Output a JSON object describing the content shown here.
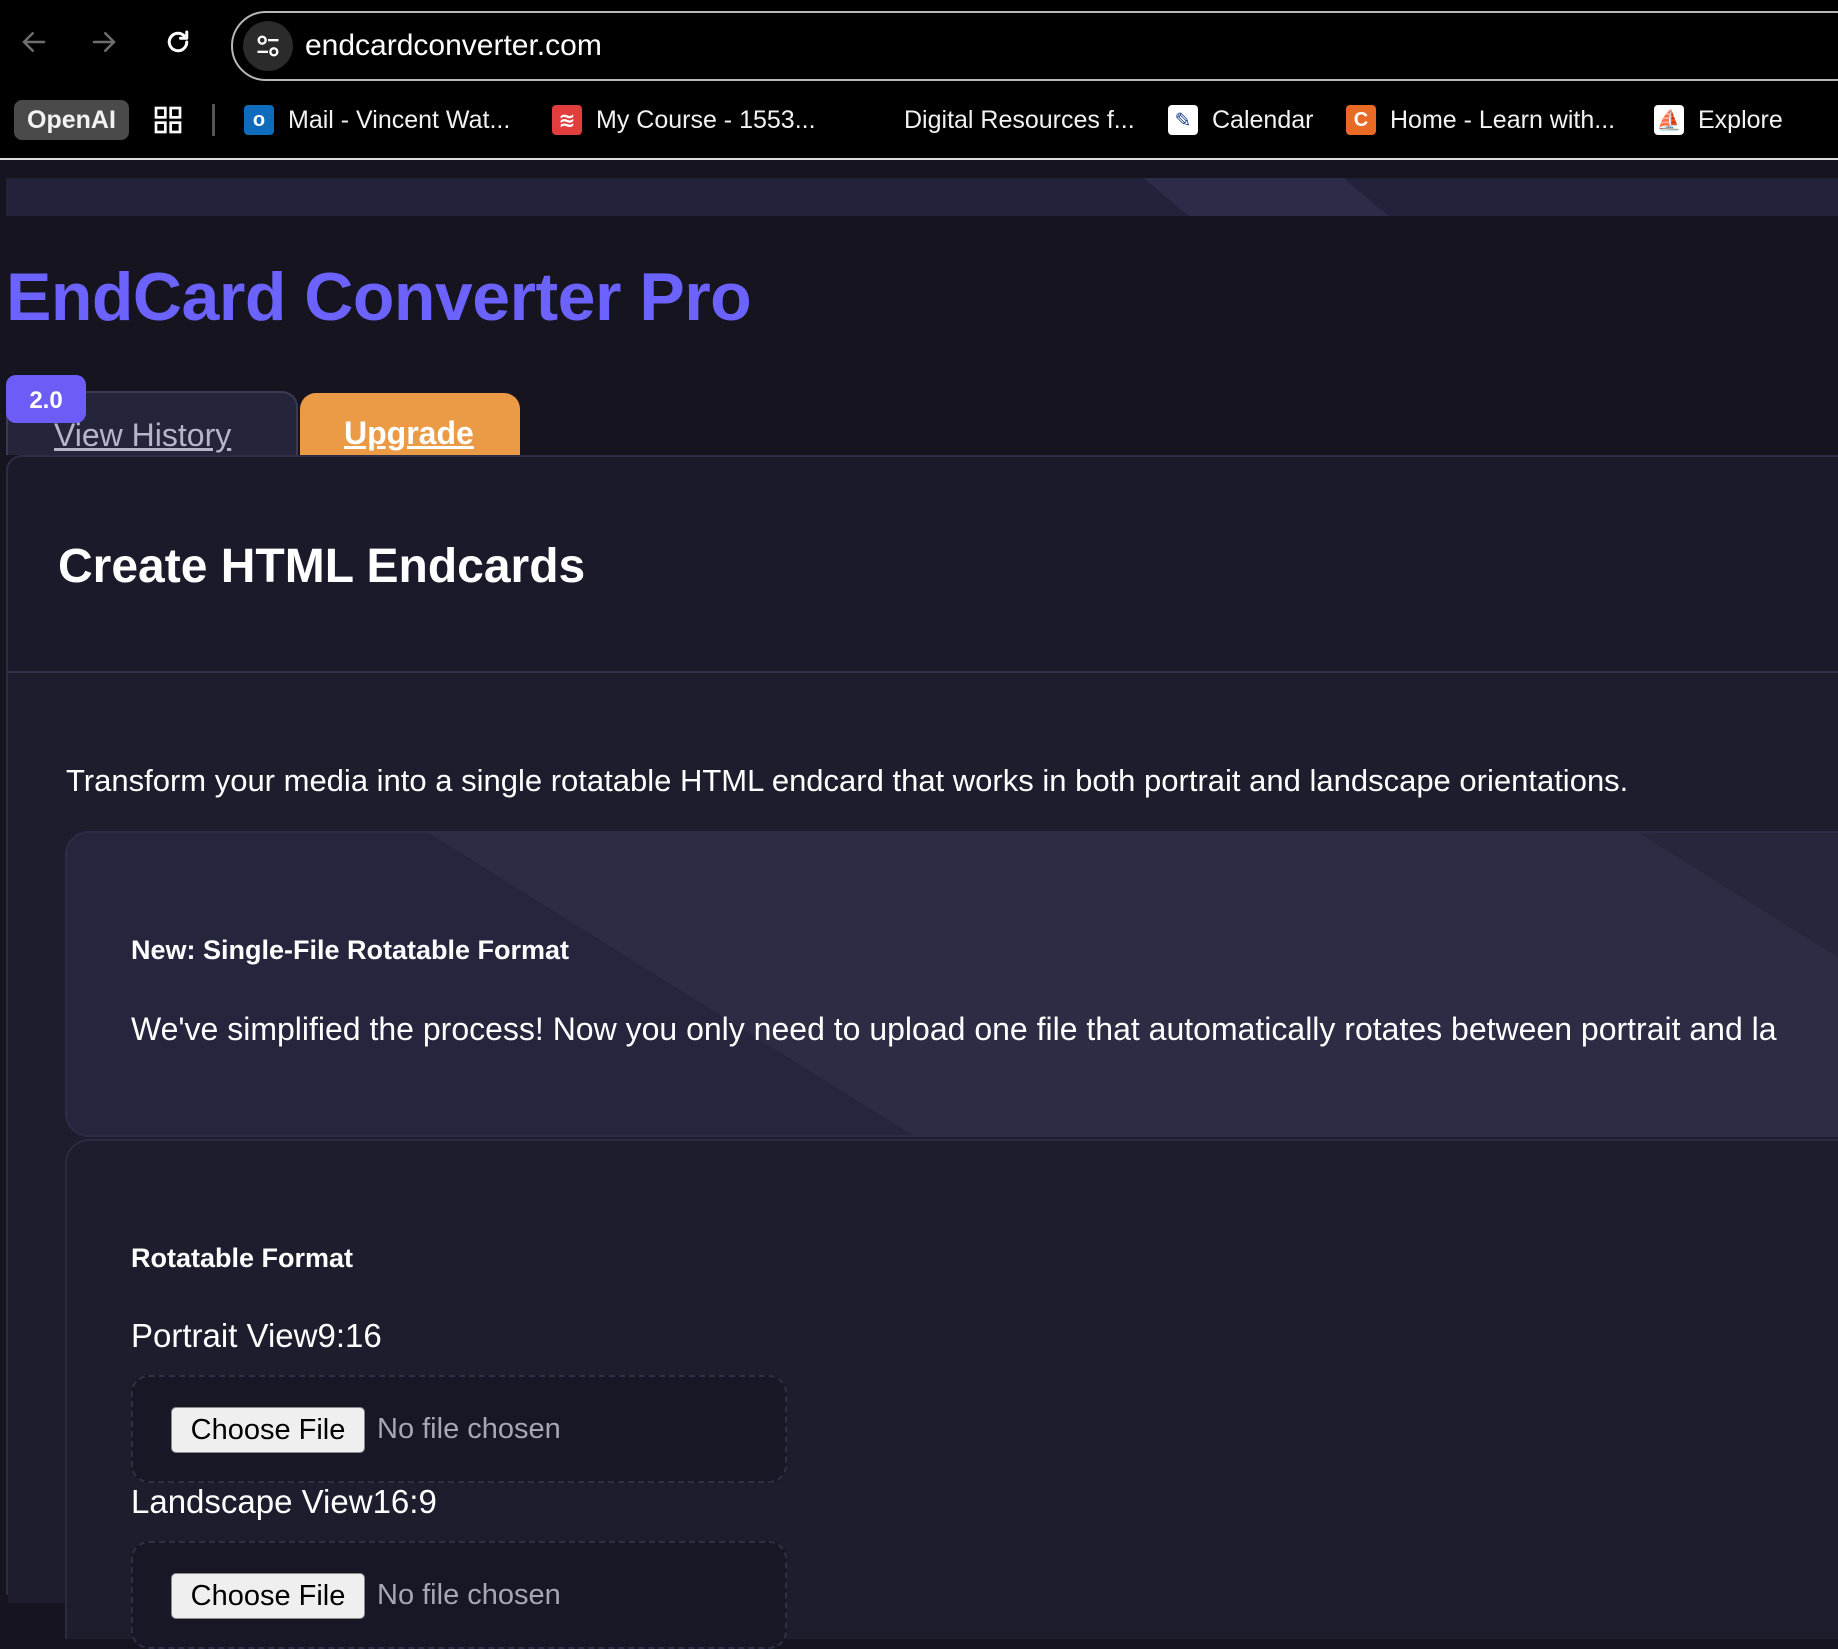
{
  "browser": {
    "url": "endcardconverter.com",
    "bookmarks": [
      {
        "label": "OpenAI"
      },
      {
        "label": "Mail - Vincent Wat..."
      },
      {
        "label": "My Course - 1553..."
      },
      {
        "label": "Digital Resources f..."
      },
      {
        "label": "Calendar"
      },
      {
        "label": "Home - Learn with..."
      },
      {
        "label": "Explore"
      }
    ],
    "icons": {
      "mail": "outlook-icon",
      "course": "course-icon",
      "calendar": "calendar-icon",
      "home": "canvas-icon",
      "explore": "sailboat-icon"
    }
  },
  "app": {
    "title": "EndCard Converter Pro",
    "version": "2.0",
    "accent_color": "#6c63ff",
    "upgrade_color": "#eb9a45"
  },
  "tabs": {
    "history": "View History",
    "upgrade": "Upgrade"
  },
  "card": {
    "title": "Create HTML Endcards",
    "intro": "Transform your media into a single rotatable HTML endcard that works in both portrait and landscape orientations."
  },
  "info": {
    "title": "New: Single-File Rotatable Format",
    "text": "We've simplified the process! Now you only need to upload one file that automatically rotates between portrait and la"
  },
  "upload": {
    "section_title": "Rotatable Format",
    "portrait_label": "Portrait View9:16",
    "landscape_label": "Landscape View16:9",
    "choose_file": "Choose File",
    "no_file": "No file chosen"
  }
}
